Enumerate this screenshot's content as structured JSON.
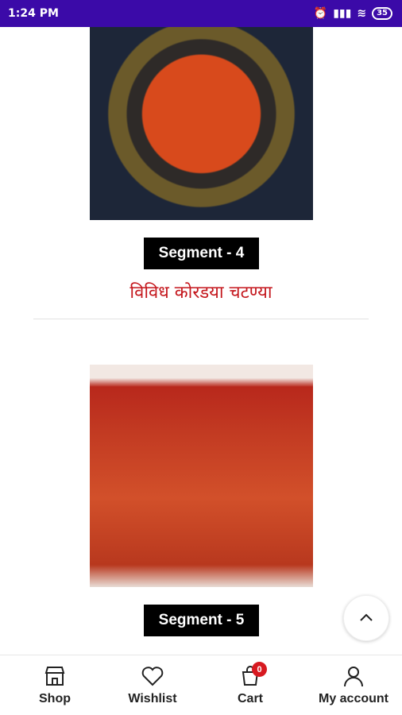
{
  "status_bar": {
    "time": "1:24 PM",
    "battery": "35"
  },
  "products": [
    {
      "segment_label": "Segment - 4",
      "title": "विविध कोरडया चटण्या"
    },
    {
      "segment_label": "Segment - 5",
      "title": ""
    }
  ],
  "bottom_nav": {
    "shop": "Shop",
    "wishlist": "Wishlist",
    "cart": "Cart",
    "cart_count": "0",
    "account": "My account"
  },
  "icons": [
    "alarm-icon",
    "signal-icon",
    "wifi-icon",
    "battery-icon",
    "chevron-up-icon",
    "shop-icon",
    "heart-icon",
    "cart-icon",
    "user-icon"
  ],
  "colors": {
    "status_bar": "#3b0aa8",
    "title_red": "#c4161c",
    "badge_black": "#000000",
    "cart_badge": "#d71920"
  }
}
